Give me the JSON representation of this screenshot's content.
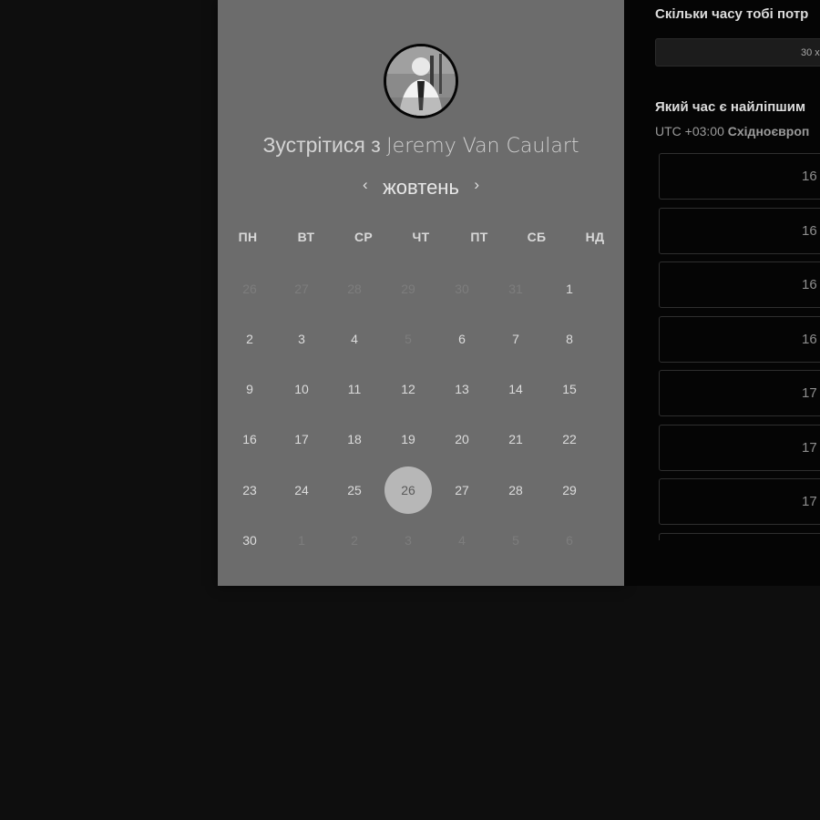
{
  "calendar": {
    "title_prefix": "Зустрітися з",
    "host_name": "Jeremy Van Caulart",
    "month": "жовтень",
    "prev_arrow": "‹",
    "next_arrow": "›",
    "weekdays": [
      "ПН",
      "ВТ",
      "СР",
      "ЧТ",
      "ПТ",
      "СБ",
      "НД"
    ],
    "weeks": [
      [
        "26",
        "27",
        "28",
        "29",
        "30",
        "31",
        "1"
      ],
      [
        "2",
        "3",
        "4",
        "5",
        "6",
        "7",
        "8"
      ],
      [
        "9",
        "10",
        "11",
        "12",
        "13",
        "14",
        "15"
      ],
      [
        "16",
        "17",
        "18",
        "19",
        "20",
        "21",
        "22"
      ],
      [
        "23",
        "24",
        "25",
        "26",
        "27",
        "28",
        "29"
      ],
      [
        "30",
        "1",
        "2",
        "3",
        "4",
        "5",
        "6"
      ]
    ],
    "muted_days": [
      "0-0",
      "0-1",
      "0-2",
      "0-3",
      "0-4",
      "0-5",
      "1-3",
      "5-1",
      "5-2",
      "5-3",
      "5-4",
      "5-5",
      "5-6"
    ],
    "selected_day": "4-3"
  },
  "booking": {
    "duration_question": "Скільки часу тобі потр",
    "duration_value": "30 х",
    "time_question": "Який час є найліпшим",
    "tz_offset": "UTC +03:00",
    "tz_name": "Східноєвроп",
    "slots": [
      "16",
      "16",
      "16",
      "16",
      "17",
      "17",
      "17",
      ""
    ]
  },
  "colors": {
    "page_bg": "#0e0e0e",
    "calendar_bg": "#6c6c6c",
    "selected_circle": "#b7b7b7",
    "right_panel_bg": "#050505"
  }
}
